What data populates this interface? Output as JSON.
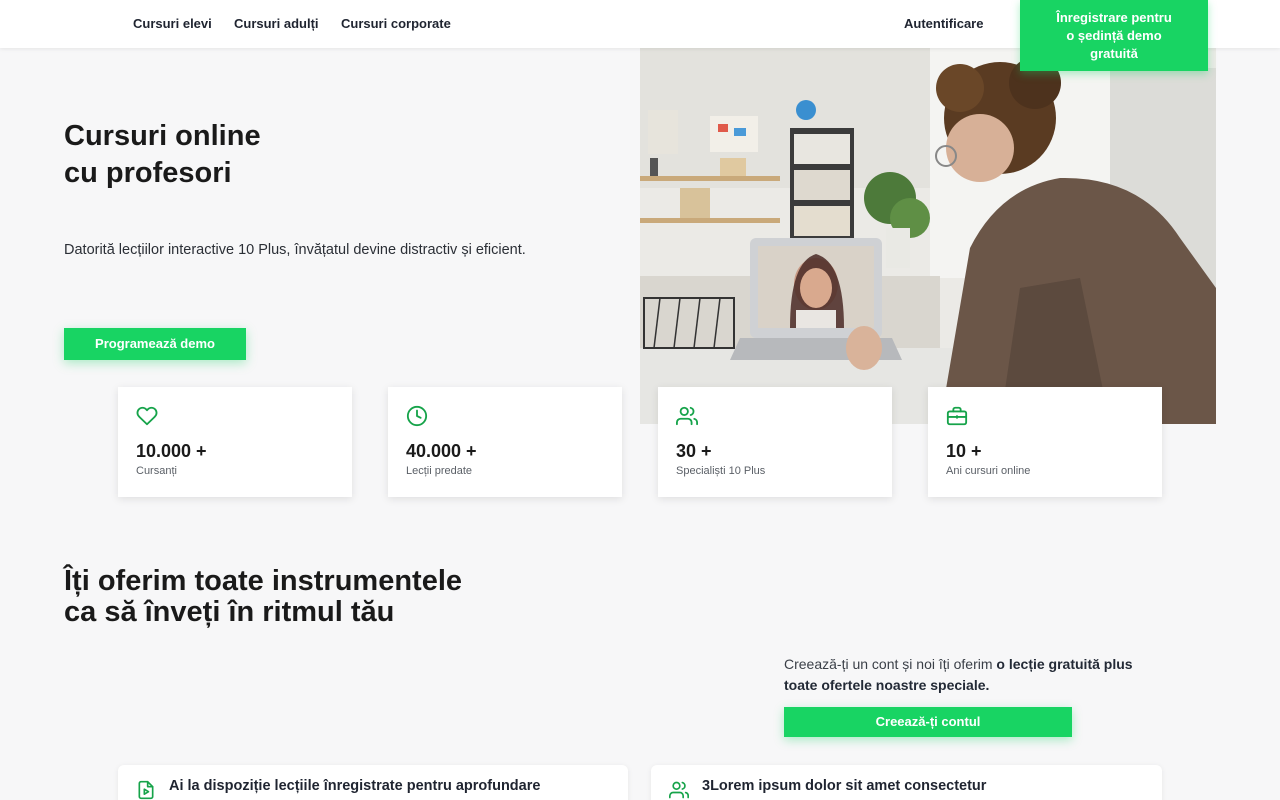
{
  "nav": {
    "links": [
      "Cursuri elevi",
      "Cursuri adulți",
      "Cursuri corporate"
    ],
    "login": "Autentificare",
    "cta_lines": [
      "Înregistrare pentru",
      "o ședință demo",
      "gratuită"
    ]
  },
  "hero": {
    "title_lines": [
      "Cursuri online",
      "cu profesori"
    ],
    "subtitle": "Datorită lecțiilor interactive 10 Plus, învățatul devine distractiv și eficient.",
    "cta": "Programează demo"
  },
  "stats": [
    {
      "icon": "heart-icon",
      "value": "10.000 +",
      "label": "Cursanți"
    },
    {
      "icon": "clock-icon",
      "value": "40.000 +",
      "label": "Lecții predate"
    },
    {
      "icon": "users-icon",
      "value": "30 +",
      "label": "Specialiști 10 Plus"
    },
    {
      "icon": "briefcase-icon",
      "value": "10 +",
      "label": "Ani cursuri online"
    }
  ],
  "tools": {
    "title_lines": [
      "Îți oferim toate instrumentele",
      "ca să înveți în ritmul tău"
    ],
    "offer_prefix": "Creează-ți un cont și noi îți oferim ",
    "offer_bold": "o lecție gratuită plus toate ofertele noastre speciale.",
    "cta": "Creează-ți contul"
  },
  "features": [
    {
      "icon": "video-file-icon",
      "text": "Ai la dispoziție lecțiile înregistrate pentru aprofundare"
    },
    {
      "icon": "users-icon",
      "text": "3Lorem ipsum dolor sit amet consectetur"
    }
  ],
  "colors": {
    "accent": "#18d463",
    "icon_green": "#16a34a",
    "background": "#f7f7f8"
  }
}
